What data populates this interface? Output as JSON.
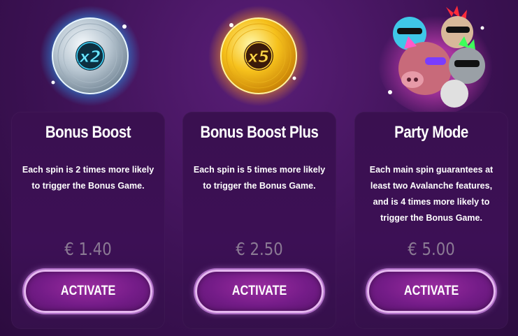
{
  "cards": [
    {
      "title": "Bonus Boost",
      "description": "Each spin is 2 times more likely to trigger the Bonus Game.",
      "price": "€ 1.40",
      "button": "ACTIVATE",
      "badge": "x2",
      "icon": "silver-x2-record-icon"
    },
    {
      "title": "Bonus Boost Plus",
      "description": "Each spin is 5 times more likely to trigger the Bonus Game.",
      "price": "€ 2.50",
      "button": "ACTIVATE",
      "badge": "x5",
      "icon": "gold-x5-record-icon"
    },
    {
      "title": "Party Mode",
      "description": "Each main spin guarantees at least two Avalanche features, and is 4 times more likely to trigger the Bonus Game.",
      "price": "€ 5.00",
      "button": "ACTIVATE",
      "icon": "party-animals-icon"
    }
  ],
  "colors": {
    "background": "#3d1255",
    "card": "#3a1050",
    "price": "#8b7a94",
    "button_fill": "#741c88",
    "button_border": "#e6b8f0"
  }
}
